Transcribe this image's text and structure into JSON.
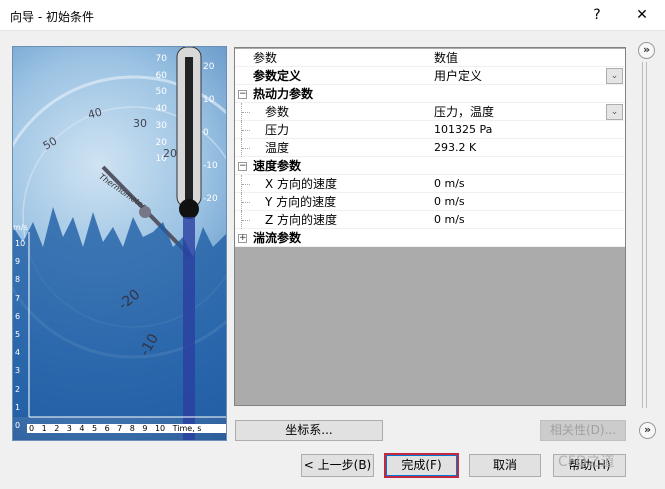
{
  "window": {
    "title": "向导 - 初始条件",
    "help_icon": "?",
    "close_icon": "✕"
  },
  "image": {
    "thermo_left_ticks": [
      "70",
      "60",
      "50",
      "40",
      "30",
      "20",
      "10"
    ],
    "thermo_right_ticks": [
      "20",
      "10",
      "0",
      "-10",
      "-20"
    ],
    "y_axis_label": "m/s",
    "y_ticks": [
      "10",
      "9",
      "8",
      "7",
      "6",
      "5",
      "4",
      "3",
      "2",
      "1",
      "0"
    ],
    "x_ticks": [
      "0",
      "1",
      "2",
      "3",
      "4",
      "5",
      "6",
      "7",
      "8",
      "9",
      "10"
    ],
    "x_axis_label": "Time, s",
    "dial_labels": [
      "50",
      "40",
      "30",
      "20",
      "-20",
      "-10"
    ],
    "brand": "Thermometer"
  },
  "grid": {
    "header": {
      "param": "参数",
      "value": "数值"
    },
    "rows": [
      {
        "label": "参数定义",
        "value": "用户定义"
      },
      {
        "label": "热动力参数",
        "value": ""
      },
      {
        "label": "参数",
        "value": "压力，温度"
      },
      {
        "label": "压力",
        "value": "101325 Pa"
      },
      {
        "label": "温度",
        "value": "293.2 K"
      },
      {
        "label": "速度参数",
        "value": ""
      },
      {
        "label": "X 方向的速度",
        "value": "0 m/s"
      },
      {
        "label": "Y 方向的速度",
        "value": "0 m/s"
      },
      {
        "label": "Z 方向的速度",
        "value": "0 m/s"
      },
      {
        "label": "湍流参数",
        "value": ""
      }
    ]
  },
  "buttons": {
    "coord": "坐标系...",
    "dependency": "相关性(D)...",
    "back": "< 上一步(B)",
    "finish": "完成(F)",
    "cancel": "取消",
    "help": "帮助(H)",
    "expand": "»"
  },
  "watermark": "CFD之道"
}
